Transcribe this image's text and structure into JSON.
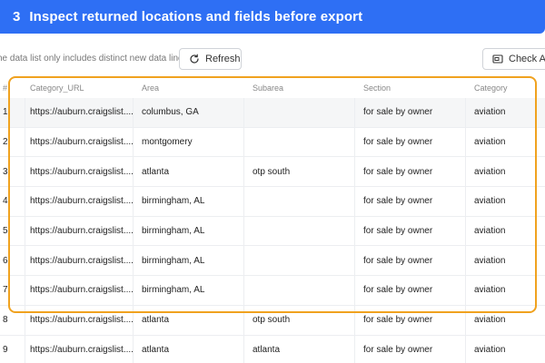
{
  "banner": {
    "step": "3",
    "title": "Inspect returned locations and fields before export",
    "color": "#2e6ff4"
  },
  "toolbar": {
    "note": "he data list only includes distinct new data lines",
    "refresh_label": "Refresh",
    "check_label": "Check All D"
  },
  "table": {
    "headers": {
      "index": "#",
      "url": "Category_URL",
      "area": "Area",
      "subarea": "Subarea",
      "section": "Section",
      "category": "Category"
    },
    "rows": [
      {
        "index": "1",
        "url": "https://auburn.craigslist....",
        "area": "columbus, GA",
        "subarea": "",
        "section": "for sale by owner",
        "category": "aviation"
      },
      {
        "index": "2",
        "url": "https://auburn.craigslist....",
        "area": "montgomery",
        "subarea": "",
        "section": "for sale by owner",
        "category": "aviation"
      },
      {
        "index": "3",
        "url": "https://auburn.craigslist....",
        "area": "atlanta",
        "subarea": "otp south",
        "section": "for sale by owner",
        "category": "aviation"
      },
      {
        "index": "4",
        "url": "https://auburn.craigslist....",
        "area": "birmingham, AL",
        "subarea": "",
        "section": "for sale by owner",
        "category": "aviation"
      },
      {
        "index": "5",
        "url": "https://auburn.craigslist....",
        "area": "birmingham, AL",
        "subarea": "",
        "section": "for sale by owner",
        "category": "aviation"
      },
      {
        "index": "6",
        "url": "https://auburn.craigslist....",
        "area": "birmingham, AL",
        "subarea": "",
        "section": "for sale by owner",
        "category": "aviation"
      },
      {
        "index": "7",
        "url": "https://auburn.craigslist....",
        "area": "birmingham, AL",
        "subarea": "",
        "section": "for sale by owner",
        "category": "aviation"
      },
      {
        "index": "8",
        "url": "https://auburn.craigslist....",
        "area": "atlanta",
        "subarea": "otp south",
        "section": "for sale by owner",
        "category": "aviation"
      },
      {
        "index": "9",
        "url": "https://auburn.craigslist....",
        "area": "atlanta",
        "subarea": "atlanta",
        "section": "for sale by owner",
        "category": "aviation"
      }
    ]
  },
  "colors": {
    "highlight": "#f0a21f",
    "row_shade": "#f5f6f7"
  }
}
